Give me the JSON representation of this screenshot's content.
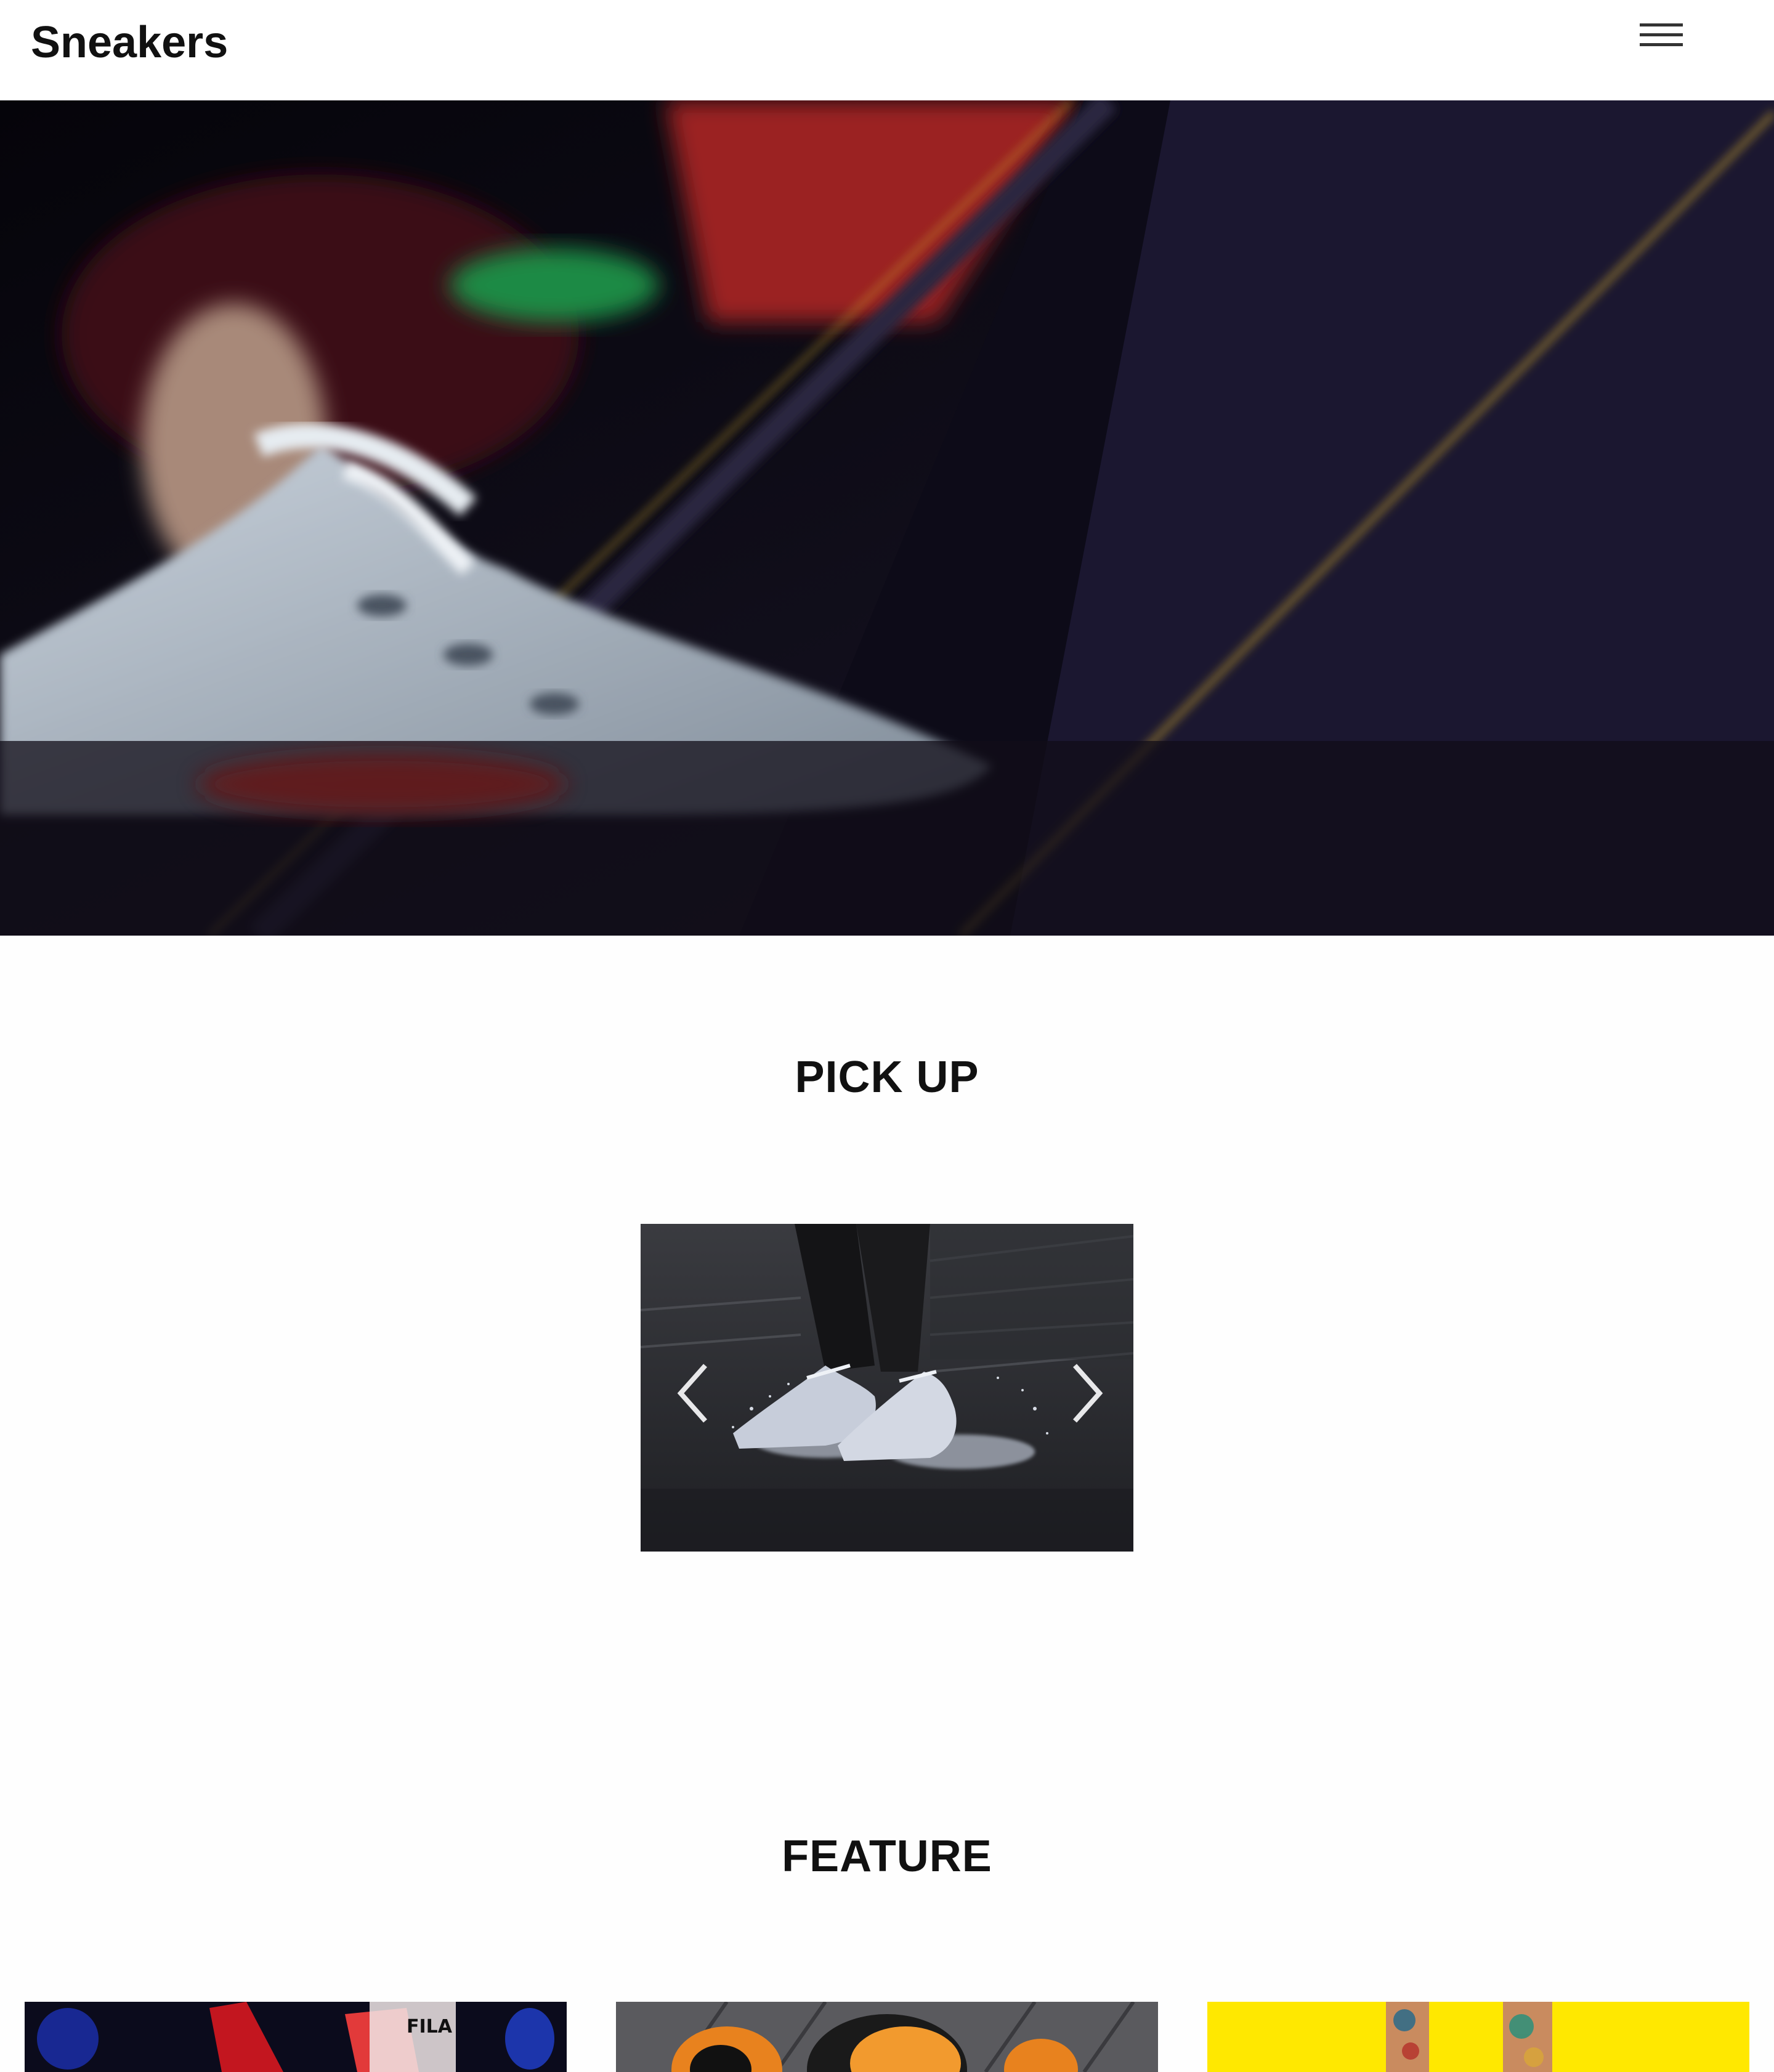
{
  "header": {
    "logo": "Sneakers",
    "menu_icon": "hamburger-menu-icon"
  },
  "hero": {
    "image": "sneaker-hero-photo"
  },
  "pickup": {
    "title": "PICK UP",
    "slide_image": "white-sneakers-splash-photo",
    "prev_icon": "chevron-left-icon",
    "next_icon": "chevron-right-icon"
  },
  "feature": {
    "title": "FEATURE",
    "cards": [
      {
        "image": "red-fila-sneaker-photo"
      },
      {
        "image": "orange-sneakers-photo"
      },
      {
        "image": "tattooed-legs-yellow-photo"
      }
    ]
  },
  "colors": {
    "background": "#fefefe",
    "text": "#111111",
    "hero_accent_yellow": "#c9a42a",
    "hero_accent_red": "#8d1f1f"
  }
}
